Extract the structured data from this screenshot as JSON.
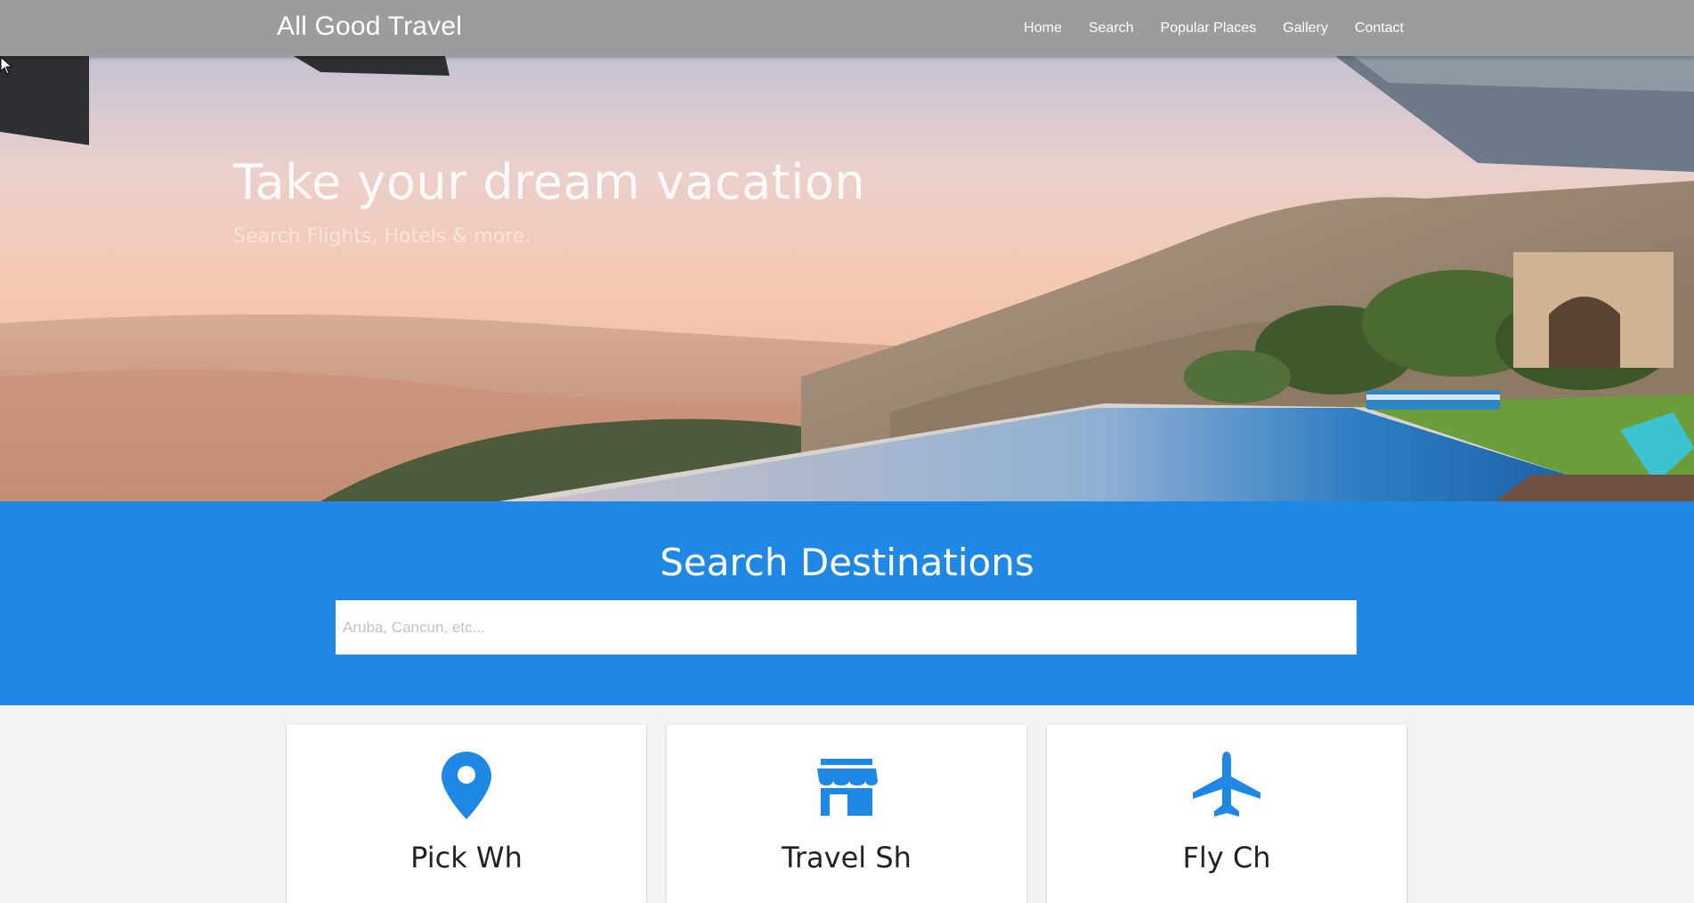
{
  "navbar": {
    "brand": "All Good Travel",
    "items": [
      {
        "label": "Home"
      },
      {
        "label": "Search"
      },
      {
        "label": "Popular Places"
      },
      {
        "label": "Gallery"
      },
      {
        "label": "Contact"
      }
    ],
    "background_color": "#9c9c9c"
  },
  "hero": {
    "title": "Take your dream vacation",
    "subtitle": "Search Flights, Hotels & more."
  },
  "search": {
    "title": "Search Destinations",
    "placeholder": "Aruba, Cancun, etc...",
    "value": "",
    "background_color": "#1f88e5"
  },
  "cards": [
    {
      "icon": "map-marker-icon",
      "title": "Pick Wh"
    },
    {
      "icon": "store-icon",
      "title": "Travel Sh"
    },
    {
      "icon": "airplane-icon",
      "title": "Fly Ch"
    }
  ],
  "accent_color": "#1f88e5"
}
